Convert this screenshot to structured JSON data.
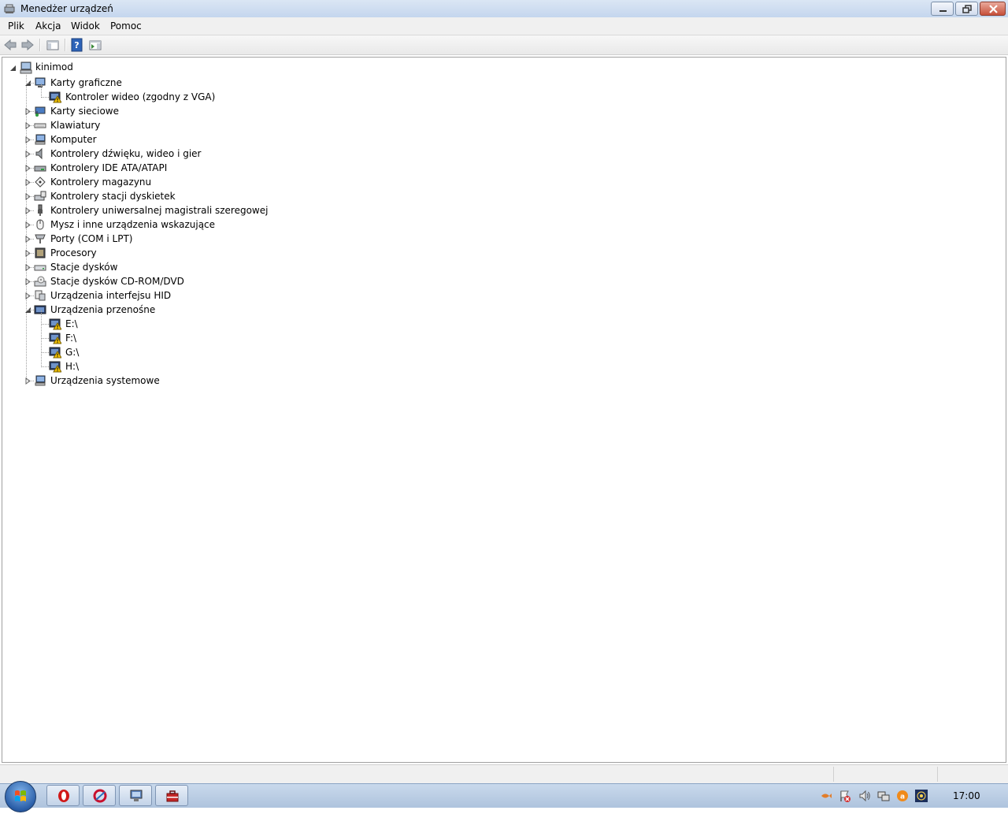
{
  "window": {
    "title": "Menedżer urządzeń"
  },
  "menu": [
    "Plik",
    "Akcja",
    "Widok",
    "Pomoc"
  ],
  "toolbar": {
    "buttons": [
      "back-arrow-icon",
      "forward-arrow-icon",
      "show-hide-console-tree-icon",
      "help-icon",
      "properties-pane-icon"
    ]
  },
  "tree": {
    "root": "kinimod",
    "categories": [
      {
        "label": "Karty graficzne",
        "icon": "display-adapter-icon",
        "expanded": true,
        "children": [
          {
            "label": "Kontroler wideo (zgodny z VGA)",
            "icon": "device-warning-icon"
          }
        ]
      },
      {
        "label": "Karty sieciowe",
        "icon": "network-adapter-icon",
        "expanded": false
      },
      {
        "label": "Klawiatury",
        "icon": "keyboard-icon",
        "expanded": false
      },
      {
        "label": "Komputer",
        "icon": "computer-icon",
        "expanded": false
      },
      {
        "label": "Kontrolery dźwięku, wideo i gier",
        "icon": "speaker-icon",
        "expanded": false
      },
      {
        "label": "Kontrolery IDE ATA/ATAPI",
        "icon": "ide-controller-icon",
        "expanded": false
      },
      {
        "label": "Kontrolery magazynu",
        "icon": "storage-controller-icon",
        "expanded": false
      },
      {
        "label": "Kontrolery stacji dyskietek",
        "icon": "floppy-controller-icon",
        "expanded": false
      },
      {
        "label": "Kontrolery uniwersalnej magistrali szeregowej",
        "icon": "usb-icon",
        "expanded": false
      },
      {
        "label": "Mysz i inne urządzenia wskazujące",
        "icon": "mouse-icon",
        "expanded": false
      },
      {
        "label": "Porty (COM i LPT)",
        "icon": "port-icon",
        "expanded": false
      },
      {
        "label": "Procesory",
        "icon": "processor-icon",
        "expanded": false
      },
      {
        "label": "Stacje dysków",
        "icon": "disk-drive-icon",
        "expanded": false
      },
      {
        "label": "Stacje dysków CD-ROM/DVD",
        "icon": "cdrom-icon",
        "expanded": false
      },
      {
        "label": "Urządzenia interfejsu HID",
        "icon": "hid-icon",
        "expanded": false
      },
      {
        "label": "Urządzenia przenośne",
        "icon": "portable-device-icon",
        "expanded": true,
        "children": [
          {
            "label": "E:\\",
            "icon": "device-warning-icon"
          },
          {
            "label": "F:\\",
            "icon": "device-warning-icon"
          },
          {
            "label": "G:\\",
            "icon": "device-warning-icon"
          },
          {
            "label": "H:\\",
            "icon": "device-warning-icon"
          }
        ]
      },
      {
        "label": "Urządzenia systemowe",
        "icon": "system-devices-icon",
        "expanded": false
      }
    ]
  },
  "taskbar": {
    "clock": "17:00",
    "pinned": [
      "opera-icon",
      "ccleaner-icon",
      "device-manager-icon",
      "toolbox-icon"
    ],
    "tray": [
      "fish-icon",
      "action-center-icon",
      "volume-icon",
      "network-icon",
      "avast-icon",
      "wireless-icon"
    ]
  },
  "colors": {
    "titlebar": "#c4d6ee",
    "taskbar": "#aec3dd",
    "warning": "#f5c400"
  }
}
